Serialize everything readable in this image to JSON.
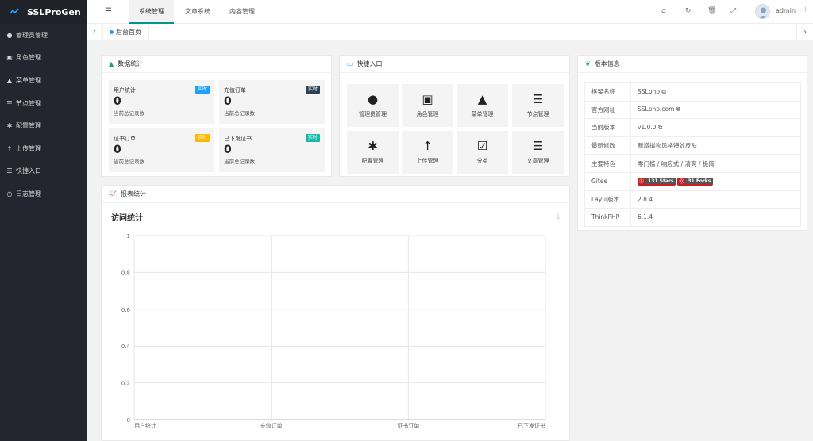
{
  "app": {
    "title": "SSLProGen"
  },
  "sidebar": {
    "items": [
      {
        "label": "管理员管理",
        "icon": "user-icon"
      },
      {
        "label": "角色管理",
        "icon": "id-card-icon"
      },
      {
        "label": "菜单管理",
        "icon": "tree-icon"
      },
      {
        "label": "节点管理",
        "icon": "list-icon"
      },
      {
        "label": "配置管理",
        "icon": "asterisk-icon"
      },
      {
        "label": "上传管理",
        "icon": "arrow-up-icon"
      },
      {
        "label": "快捷入口",
        "icon": "list-icon"
      },
      {
        "label": "日志管理",
        "icon": "clock-icon"
      }
    ]
  },
  "header": {
    "tabs": [
      {
        "label": "系统管理",
        "active": true
      },
      {
        "label": "文章系统",
        "active": false
      },
      {
        "label": "内容管理",
        "active": false
      }
    ],
    "username": "admin"
  },
  "tabbar": {
    "home_tab": "后台首页"
  },
  "stats_card": {
    "title": "数据统计",
    "items": [
      {
        "label": "用户统计",
        "value": "0",
        "sub": "当前总记录数",
        "badge": "实时",
        "badge_color": "#1e9fff"
      },
      {
        "label": "充值订单",
        "value": "0",
        "sub": "当前总记录数",
        "badge": "实时",
        "badge_color": "#2f4056"
      },
      {
        "label": "证书订单",
        "value": "0",
        "sub": "当前总记录数",
        "badge": "实时",
        "badge_color": "#ffb800"
      },
      {
        "label": "已下发证书",
        "value": "0",
        "sub": "当前总记录数",
        "badge": "实时",
        "badge_color": "#16baaa"
      }
    ]
  },
  "quick_card": {
    "title": "快捷入口",
    "items": [
      {
        "label": "管理员管理",
        "icon": "user-icon"
      },
      {
        "label": "角色管理",
        "icon": "id-card-icon"
      },
      {
        "label": "菜单管理",
        "icon": "tree-icon"
      },
      {
        "label": "节点管理",
        "icon": "list-icon"
      },
      {
        "label": "配置管理",
        "icon": "asterisk-icon"
      },
      {
        "label": "上传管理",
        "icon": "arrow-up-icon"
      },
      {
        "label": "分类",
        "icon": "calendar-check-icon"
      },
      {
        "label": "文章管理",
        "icon": "list-icon"
      }
    ]
  },
  "version_card": {
    "title": "版本信息",
    "rows": [
      {
        "key": "框架名称",
        "value": "SSLphp",
        "copy": true
      },
      {
        "key": "官方网址",
        "value": "SSLphp.com",
        "copy": true
      },
      {
        "key": "当前版本",
        "value": "v1.0.0",
        "copy": true
      },
      {
        "key": "最新修改",
        "value": "新增拟物风格特效皮肤"
      },
      {
        "key": "主要特色",
        "value": "零门槛 / 响应式 / 清爽 / 极简"
      },
      {
        "key": "Gitee",
        "stars": "131 Stars",
        "forks": "31 Forks"
      },
      {
        "key": "Layui版本",
        "value": "2.8.4"
      },
      {
        "key": "ThinkPHP",
        "value": "6.1.4"
      }
    ]
  },
  "report_card": {
    "title": "报表统计"
  },
  "chart_data": {
    "type": "bar",
    "title": "访问统计",
    "categories": [
      "用户统计",
      "充值订单",
      "证书订单",
      "已下发证书"
    ],
    "values": [
      0,
      0,
      0,
      0
    ],
    "yticks": [
      "0",
      "0.2",
      "0.4",
      "0.6",
      "0.8",
      "1"
    ],
    "ylim": [
      0,
      1
    ],
    "grid": true,
    "xlabel": "",
    "ylabel": ""
  }
}
